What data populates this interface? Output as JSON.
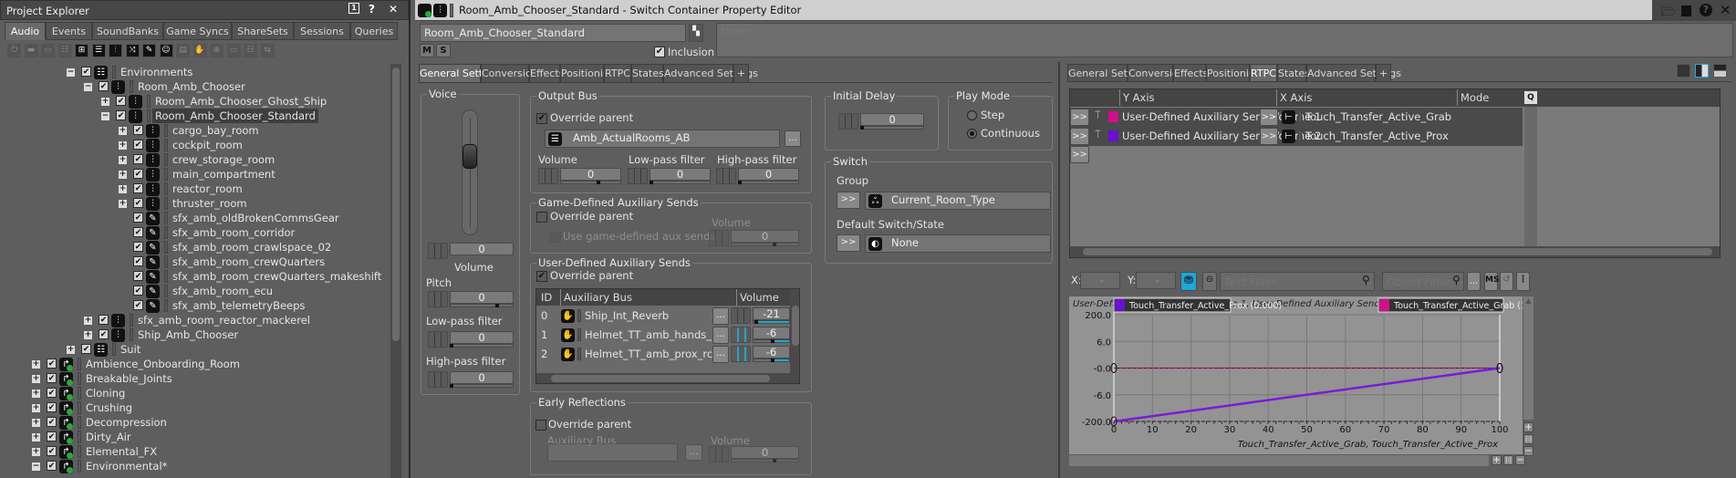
{
  "explorer": {
    "title": "Project Explorer",
    "tabs": [
      "Audio",
      "Events",
      "SoundBanks",
      "Game Syncs",
      "ShareSets",
      "Sessions",
      "Queries"
    ],
    "active_tab": "Audio",
    "tree": [
      {
        "name": "Environments",
        "level": 2,
        "expander": "-",
        "icon": "actor-mixer"
      },
      {
        "name": "Room_Amb_Chooser",
        "level": 3,
        "expander": "-",
        "icon": "switch-container"
      },
      {
        "name": "Room_Amb_Chooser_Ghost_Ship",
        "level": 4,
        "expander": "+",
        "icon": "switch-container"
      },
      {
        "name": "Room_Amb_Chooser_Standard",
        "level": 4,
        "expander": "-",
        "icon": "switch-container",
        "selected": true
      },
      {
        "name": "cargo_bay_room",
        "level": 5,
        "expander": "+",
        "icon": "switch-container"
      },
      {
        "name": "cockpit_room",
        "level": 5,
        "expander": "+",
        "icon": "switch-container"
      },
      {
        "name": "crew_storage_room",
        "level": 5,
        "expander": "+",
        "icon": "switch-container"
      },
      {
        "name": "main_compartment",
        "level": 5,
        "expander": "+",
        "icon": "switch-container"
      },
      {
        "name": "reactor_room",
        "level": 5,
        "expander": "+",
        "icon": "switch-container"
      },
      {
        "name": "thruster_room",
        "level": 5,
        "expander": "+",
        "icon": "switch-container"
      },
      {
        "name": "sfx_amb_oldBrokenCommsGear",
        "level": 5,
        "expander": "",
        "icon": "sound"
      },
      {
        "name": "sfx_amb_room_corridor",
        "level": 5,
        "expander": "",
        "icon": "sound"
      },
      {
        "name": "sfx_amb_room_crawlspace_02",
        "level": 5,
        "expander": "",
        "icon": "sound"
      },
      {
        "name": "sfx_amb_room_crewQuarters",
        "level": 5,
        "expander": "",
        "icon": "sound"
      },
      {
        "name": "sfx_amb_room_crewQuarters_makeshift",
        "level": 5,
        "expander": "",
        "icon": "sound"
      },
      {
        "name": "sfx_amb_room_ecu",
        "level": 5,
        "expander": "",
        "icon": "sound"
      },
      {
        "name": "sfx_amb_telemetryBeeps",
        "level": 5,
        "expander": "",
        "icon": "sound"
      },
      {
        "name": "sfx_amb_room_reactor_mackerel",
        "level": 3,
        "expander": "+",
        "icon": "switch-container"
      },
      {
        "name": "Ship_Amb_Chooser",
        "level": 3,
        "expander": "+",
        "icon": "switch-container"
      },
      {
        "name": "Suit",
        "level": 2,
        "expander": "+",
        "icon": "actor-mixer"
      },
      {
        "name": "Ambience_Onboarding_Room",
        "level": 0,
        "expander": "+",
        "icon": "work-unit"
      },
      {
        "name": "Breakable_Joints",
        "level": 0,
        "expander": "+",
        "icon": "work-unit"
      },
      {
        "name": "Cloning",
        "level": 0,
        "expander": "+",
        "icon": "work-unit"
      },
      {
        "name": "Crushing",
        "level": 0,
        "expander": "+",
        "icon": "work-unit"
      },
      {
        "name": "Decompression",
        "level": 0,
        "expander": "+",
        "icon": "work-unit"
      },
      {
        "name": "Dirty_Air",
        "level": 0,
        "expander": "+",
        "icon": "work-unit"
      },
      {
        "name": "Elemental_FX",
        "level": 0,
        "expander": "+",
        "icon": "work-unit"
      },
      {
        "name": "Environmental*",
        "level": 0,
        "expander": "-",
        "icon": "work-unit"
      }
    ]
  },
  "editor": {
    "title": "Room_Amb_Chooser_Standard - Switch Container Property Editor",
    "object_name": "Room_Amb_Chooser_Standard",
    "notes_placeholder": "Notes",
    "mute": "M",
    "solo": "S",
    "inclusion_label": "Inclusion",
    "inclusion_checked": true,
    "tabs": [
      "General Settings",
      "Conversion",
      "Effects",
      "Positioning",
      "RTPC",
      "States",
      "Advanced Settings",
      "+"
    ],
    "left_active": "General Settings",
    "right_active": "RTPC"
  },
  "general": {
    "voice": {
      "title": "Voice",
      "volume_label": "Volume",
      "volume": "0",
      "pitch_label": "Pitch",
      "pitch": "0",
      "lpf_label": "Low-pass filter",
      "lpf": "0",
      "hpf_label": "High-pass filter",
      "hpf": "0"
    },
    "output_bus": {
      "title": "Output Bus",
      "override_label": "Override parent",
      "override": true,
      "bus": "Amb_ActualRooms_AB",
      "browse": "...",
      "volume_label": "Volume",
      "volume": "0",
      "lpf_label": "Low-pass filter",
      "lpf": "0",
      "hpf_label": "High-pass filter",
      "hpf": "0"
    },
    "game_aux": {
      "title": "Game-Defined Auxiliary Sends",
      "override_label": "Override parent",
      "override": false,
      "use_label": "Use game-defined aux sends",
      "volume_label": "Volume",
      "volume": "0"
    },
    "user_aux": {
      "title": "User-Defined Auxiliary Sends",
      "override_label": "Override parent",
      "override": true,
      "headers": {
        "id": "ID",
        "bus": "Auxiliary Bus",
        "volume": "Volume"
      },
      "rows": [
        {
          "id": "0",
          "bus": "Ship_Int_Reverb",
          "volume": "-21"
        },
        {
          "id": "1",
          "bus": "Helmet_TT_amb_hands_rcv",
          "volume": "-6"
        },
        {
          "id": "2",
          "bus": "Helmet_TT_amb_prox_rcv",
          "volume": "-6"
        }
      ]
    },
    "early_reflections": {
      "title": "Early Reflections",
      "override_label": "Override parent",
      "override": false,
      "bus_label": "Auxiliary Bus",
      "volume_label": "Volume",
      "volume": "0"
    },
    "initial_delay": {
      "title": "Initial Delay",
      "value": "0"
    },
    "play_mode": {
      "title": "Play Mode",
      "options": [
        "Step",
        "Continuous"
      ],
      "selected": "Continuous"
    },
    "switch": {
      "title": "Switch",
      "group_label": "Group",
      "group": "Current_Room_Type",
      "default_label": "Default Switch/State",
      "default": "None",
      "pick": ">>"
    }
  },
  "rtpc": {
    "headers": {
      "y": "Y Axis",
      "x": "X Axis",
      "mode": "Mode"
    },
    "rows": [
      {
        "y": "User-Defined Auxiliary Send Volume 1",
        "x": "Touch_Transfer_Active_Grab",
        "color": "#d0108a"
      },
      {
        "y": "User-Defined Auxiliary Send Volume 2",
        "x": "Touch_Transfer_Active_Prox",
        "color": "#6a10d0"
      }
    ],
    "pick": ">>",
    "x_label": "X:",
    "y_label": "Y:",
    "x_value": "-",
    "y_value": "-",
    "text_filter_placeholder": "Text Filter",
    "object_filter_placeholder": "Object Filter",
    "more": "..."
  },
  "chart_data": {
    "type": "line",
    "title": "User-Defined Auxiliary Send Volume 1, User-Defined Auxiliary Send Volume 2",
    "xlabel": "Touch_Transfer_Active_Grab, Touch_Transfer_Active_Prox",
    "xlim": [
      0,
      100
    ],
    "x_ticks": [
      "0",
      "10",
      "20",
      "30",
      "40",
      "50",
      "60",
      "70",
      "80",
      "90",
      "100"
    ],
    "y_ticks": [
      200,
      6,
      0,
      -6,
      -200
    ],
    "y_tick_labels": [
      "200.0",
      "6.0",
      "-0.0",
      "-6.0",
      "-200.0"
    ],
    "grid": true,
    "legend": [
      {
        "label": "Touch_Transfer_Active_Prox (0.000)",
        "color": "#6a10d0",
        "position": "top-left"
      },
      {
        "label": "Touch_Transfer_Active_Grab (100.000)",
        "color": "#d0108a",
        "position": "top-right"
      }
    ],
    "series": [
      {
        "name": "User-Defined Auxiliary Send Volume 1",
        "color": "#d0108a",
        "points": [
          [
            0,
            0
          ],
          [
            100,
            0
          ]
        ]
      },
      {
        "name": "User-Defined Auxiliary Send Volume 2",
        "color": "#7a1ad8",
        "points": [
          [
            0,
            -200
          ],
          [
            100,
            0
          ]
        ]
      }
    ]
  }
}
